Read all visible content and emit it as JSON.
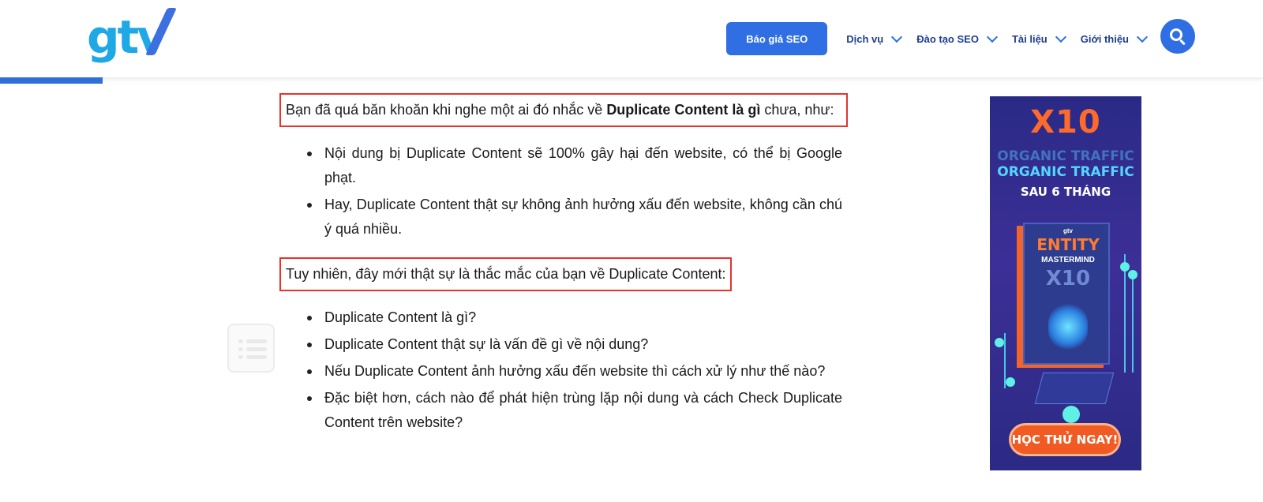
{
  "header": {
    "logo_text": "gtv",
    "quote_button": "Báo giá SEO",
    "nav": [
      {
        "label": "Dịch vụ"
      },
      {
        "label": "Đào tạo SEO"
      },
      {
        "label": "Tài liệu"
      },
      {
        "label": "Giới thiệu"
      }
    ],
    "accent_color": "#2f6fe3"
  },
  "content": {
    "intro_prefix": "Bạn đã quá băn khoăn khi nghe một ai đó nhắc về ",
    "intro_bold": "Duplicate Content là gì",
    "intro_suffix": " chưa, như:",
    "list1": [
      "Nội dung bị Duplicate Content sẽ 100% gây hại đến website, có thể bị Google phạt.",
      "Hay, Duplicate Content thật sự không ảnh hưởng xấu đến website, không cần chú ý quá nhiều."
    ],
    "question_para": "Tuy nhiên, đây mới thật sự là thắc mắc của bạn về Duplicate Content:",
    "list2": [
      "Duplicate Content là gì?",
      "Duplicate Content thật sự là vấn đề gì về nội dung?",
      "Nếu Duplicate Content ảnh hưởng xấu đến website thì cách xử lý như thế nào?",
      "Đặc biệt hơn, cách nào để phát hiện trùng lặp nội dung và cách Check Duplicate Content trên website?"
    ],
    "highlight_color": "#e8322b"
  },
  "ad": {
    "headline": "X10",
    "ghost_line": "ORGANIC TRAFFIC",
    "line1": "ORGANIC TRAFFIC",
    "line2": "SAU 6 THÁNG",
    "book_brand": "gtv",
    "book_title": "ENTITY",
    "book_subtitle": "MASTERMIND",
    "book_mark": "X10",
    "cta": "HỌC THỬ NGAY!"
  }
}
